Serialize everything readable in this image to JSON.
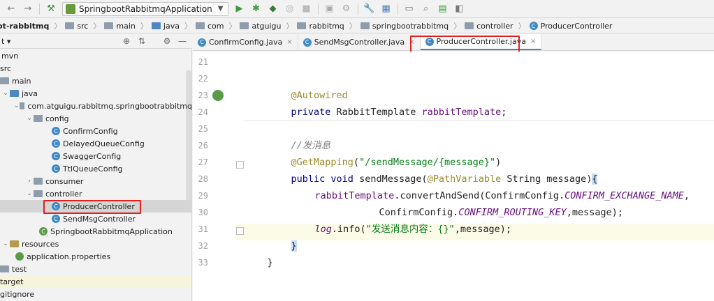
{
  "toolbar": {
    "run_config": "SpringbootRabbitmqApplication"
  },
  "breadcrumb": [
    "ot-rabbitmq",
    "src",
    "main",
    "java",
    "com",
    "atguigu",
    "rabbitmq",
    "springbootrabbitmq",
    "controller",
    "ProducerController"
  ],
  "project_panel": {
    "header": "t"
  },
  "tree": [
    {
      "label": "mvn",
      "depth": 0
    },
    {
      "label": "src",
      "depth": 0
    },
    {
      "label": "main",
      "depth": 1
    },
    {
      "label": "java",
      "depth": 2
    },
    {
      "label": "com.atguigu.rabbitmq.springbootrabbitmq",
      "depth": 3
    },
    {
      "label": "config",
      "depth": 4
    },
    {
      "label": "ConfirmConfig",
      "depth": 5
    },
    {
      "label": "DelayedQueueConfig",
      "depth": 5
    },
    {
      "label": "SwaggerConfig",
      "depth": 5
    },
    {
      "label": "TtlQueueConfig",
      "depth": 5
    },
    {
      "label": "consumer",
      "depth": 4
    },
    {
      "label": "controller",
      "depth": 4
    },
    {
      "label": "ProducerController",
      "depth": 5
    },
    {
      "label": "SendMsgController",
      "depth": 5
    },
    {
      "label": "SpringbootRabbitmqApplication",
      "depth": 4
    },
    {
      "label": "resources",
      "depth": 2
    },
    {
      "label": "application.properties",
      "depth": 3
    },
    {
      "label": "test",
      "depth": 1
    },
    {
      "label": "target",
      "depth": 0
    },
    {
      "label": "gitignore",
      "depth": 0
    }
  ],
  "tabs": [
    {
      "label": "ConfirmConfig.java"
    },
    {
      "label": "SendMsgController.java"
    },
    {
      "label": "ProducerController.java"
    }
  ],
  "editor": {
    "line_numbers": [
      "21",
      "22",
      "23",
      "24",
      "25",
      "26",
      "27",
      "28",
      "29",
      "30",
      "31",
      "32",
      "33"
    ],
    "lines": {
      "l22_annot": "@Autowired",
      "l23_kw": "private ",
      "l23_type": "RabbitTemplate ",
      "l23_field": "rabbitTemplate",
      "l23_end": ";",
      "l25_cmt": "//发消息",
      "l26_annot": "@GetMapping",
      "l26_open": "(",
      "l26_str": "\"/sendMessage/{message}\"",
      "l26_close": ")",
      "l27_kw": "public void ",
      "l27_name": "sendMessage(",
      "l27_annot": "@PathVariable",
      "l27_rest": " String message)",
      "l27_brace": "{",
      "l28_field": "rabbitTemplate",
      "l28_call": ".convertAndSend(ConfirmConfig.",
      "l28_const": "CONFIRM_EXCHANGE_NAME",
      "l28_end": ",",
      "l29_pre": "ConfirmConfig.",
      "l29_const": "CONFIRM_ROUTING_KEY",
      "l29_end": ",message);",
      "l30_log": "log",
      "l30_call": ".info(",
      "l30_str": "\"发送消息内容：{}\"",
      "l30_end": ",message);",
      "l31_brace": "}",
      "l32_brace": "}"
    }
  }
}
